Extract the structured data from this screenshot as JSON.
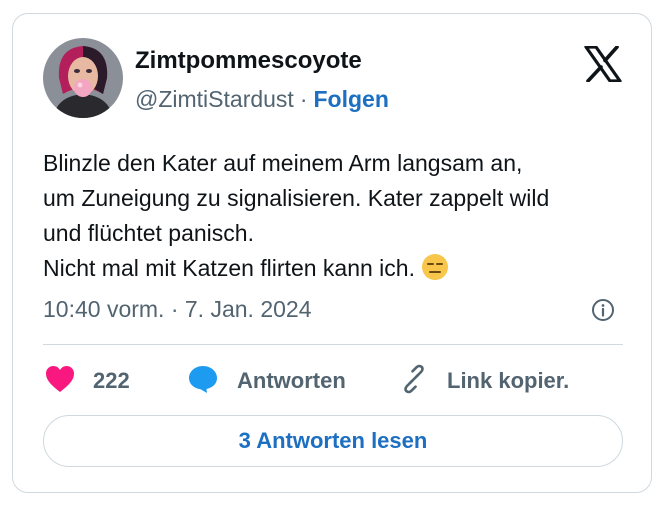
{
  "author": {
    "display_name": "Zimtpommescoyote",
    "handle": "@ZimtiStardust",
    "separator": "·",
    "follow_label": "Folgen"
  },
  "tweet": {
    "lines": [
      "Blinzle den Kater auf meinem Arm langsam an,",
      "um Zuneigung zu signalisieren. Kater zappelt wild",
      "und flüchtet panisch.",
      "Nicht mal mit Katzen flirten kann ich."
    ],
    "emoji": "expressionless-face",
    "timestamp": "10:40 vorm. · 7. Jan. 2024"
  },
  "actions": {
    "like_count": "222",
    "reply_label": "Antworten",
    "copy_link_label": "Link kopier.",
    "read_replies_label": "3 Antworten lesen"
  },
  "icons": [
    "x-logo-icon",
    "info-icon",
    "heart-icon",
    "speech-bubble-icon",
    "link-icon"
  ],
  "colors": {
    "link_blue": "#1d6fc1",
    "heart_red": "#f91880",
    "reply_blue": "#1d9bf0",
    "muted_text": "#536471",
    "border": "#cfd9de"
  }
}
